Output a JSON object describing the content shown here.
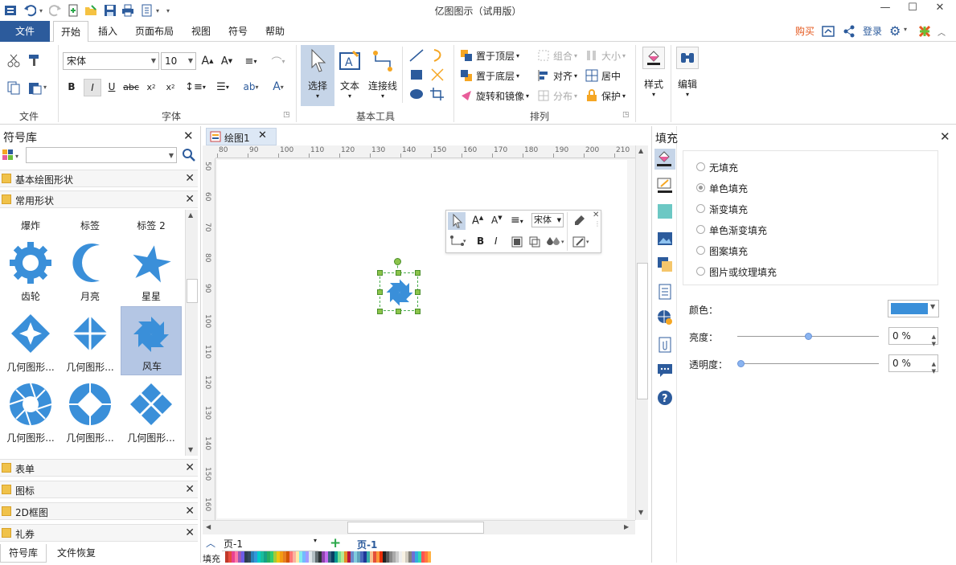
{
  "app": {
    "title": "亿图图示（试用版）",
    "brand_color": "#2c5b9c",
    "accent_color": "#3a8fd9"
  },
  "menu": {
    "file": "文件",
    "tabs": [
      "开始",
      "插入",
      "页面布局",
      "视图",
      "符号",
      "帮助"
    ],
    "active_tab": "开始",
    "buy": "购买",
    "login": "登录"
  },
  "ribbon": {
    "groups": {
      "file": "文件",
      "font": "字体",
      "basic_tools": "基本工具",
      "arrange": "排列"
    },
    "font_name": "宋体",
    "font_size": "10",
    "tools": {
      "select": "选择",
      "text": "文本",
      "connector": "连接线"
    },
    "arrange": {
      "bring_front": "置于顶层",
      "send_back": "置于底层",
      "rotate_mirror": "旋转和镜像",
      "group": "组合",
      "align": "对齐",
      "distribute": "分布",
      "size": "大小",
      "center": "居中",
      "protect": "保护"
    },
    "style": "样式",
    "edit": "编辑"
  },
  "library": {
    "title": "符号库",
    "search_placeholder": "",
    "categories_top": [
      "基本绘图形状",
      "常用形状"
    ],
    "shapes": [
      {
        "label": "爆炸",
        "icon": "explosion-icon"
      },
      {
        "label": "标签",
        "icon": "tag-icon"
      },
      {
        "label": "标签 2",
        "icon": "tag2-icon"
      },
      {
        "label": "齿轮",
        "icon": "gear-shape-icon"
      },
      {
        "label": "月亮",
        "icon": "moon-icon"
      },
      {
        "label": "星星",
        "icon": "star-icon"
      },
      {
        "label": "几何图形...",
        "icon": "geometry-diamond-icon"
      },
      {
        "label": "几何图形...",
        "icon": "geometry-cross-icon"
      },
      {
        "label": "风车",
        "icon": "pinwheel-icon",
        "selected": true
      },
      {
        "label": "几何图形...",
        "icon": "aperture-icon"
      },
      {
        "label": "几何图形...",
        "icon": "geometry-circle-icon"
      },
      {
        "label": "几何图形...",
        "icon": "geometry-diamonds-icon"
      }
    ],
    "categories_bottom": [
      "表单",
      "图标",
      "2D框图",
      "礼券"
    ],
    "bottom_tabs": [
      "符号库",
      "文件恢复"
    ]
  },
  "document": {
    "tab_name": "绘图1",
    "ruler_h": [
      "80",
      "90",
      "100",
      "110",
      "120",
      "130",
      "140",
      "150",
      "160",
      "170",
      "180",
      "190",
      "200",
      "210"
    ],
    "ruler_v": [
      "50",
      "60",
      "70",
      "80",
      "90",
      "100",
      "110",
      "120",
      "130",
      "140",
      "150",
      "160"
    ],
    "float_font": "宋体"
  },
  "status": {
    "page_select": "页-1",
    "page_tab": "页-1",
    "fill_label": "填充"
  },
  "fill_panel": {
    "title": "填充",
    "options": [
      "无填充",
      "单色填充",
      "渐变填充",
      "单色渐变填充",
      "图案填充",
      "图片或纹理填充"
    ],
    "selected_option": "单色填充",
    "color_label": "颜色：",
    "color_value": "#3a8fd9",
    "brightness_label": "亮度：",
    "brightness_value": "0 %",
    "brightness_level": 0.5,
    "transparency_label": "透明度：",
    "transparency_value": "0 %",
    "transparency_level": 0
  }
}
